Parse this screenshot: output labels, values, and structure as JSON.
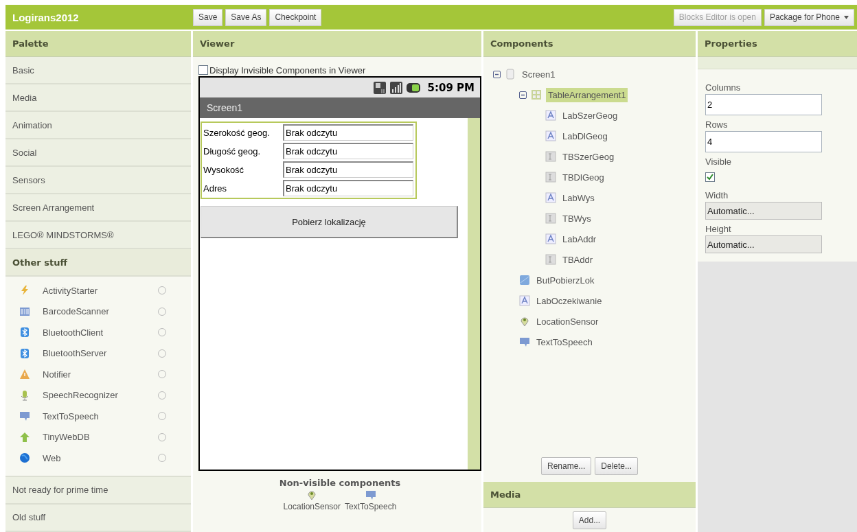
{
  "app_title": "Logirans2012",
  "toolbar": {
    "left": [
      {
        "label": "Save",
        "disabled": false,
        "menu": false
      },
      {
        "label": "Save As",
        "disabled": false,
        "menu": false
      },
      {
        "label": "Checkpoint",
        "disabled": false,
        "menu": false
      }
    ],
    "right": [
      {
        "label": "Blocks Editor is open",
        "disabled": true,
        "menu": false
      },
      {
        "label": "Package for Phone",
        "disabled": false,
        "menu": true
      }
    ]
  },
  "palette": {
    "title": "Palette",
    "groups": [
      {
        "label": "Basic",
        "expanded": false
      },
      {
        "label": "Media",
        "expanded": false
      },
      {
        "label": "Animation",
        "expanded": false
      },
      {
        "label": "Social",
        "expanded": false
      },
      {
        "label": "Sensors",
        "expanded": false
      },
      {
        "label": "Screen Arrangement",
        "expanded": false
      },
      {
        "label": "LEGO® MINDSTORMS®",
        "expanded": false
      },
      {
        "label": "Other stuff",
        "expanded": true,
        "items": [
          {
            "label": "ActivityStarter",
            "kind": "bolt"
          },
          {
            "label": "BarcodeScanner",
            "kind": "barcode"
          },
          {
            "label": "BluetoothClient",
            "kind": "bluetooth"
          },
          {
            "label": "BluetoothServer",
            "kind": "bluetooth"
          },
          {
            "label": "Notifier",
            "kind": "warning"
          },
          {
            "label": "SpeechRecognizer",
            "kind": "microphone"
          },
          {
            "label": "TextToSpeech",
            "kind": "speech"
          },
          {
            "label": "TinyWebDB",
            "kind": "arrow"
          },
          {
            "label": "Web",
            "kind": "globe"
          }
        ]
      },
      {
        "label": "Not ready for prime time",
        "expanded": false
      },
      {
        "label": "Old stuff",
        "expanded": false
      }
    ]
  },
  "viewer": {
    "title": "Viewer",
    "invisible_toggle": {
      "label": "Display Invisible Components in Viewer",
      "checked": false
    },
    "phone": {
      "time": "5:09 PM",
      "screen_title": "Screen1",
      "rows": [
        {
          "label": "Szerokość geog.",
          "value": "Brak odczytu"
        },
        {
          "label": "Długość geog.",
          "value": "Brak odczytu"
        },
        {
          "label": "Wysokość",
          "value": "Brak odczytu"
        },
        {
          "label": "Adres",
          "value": "Brak odczytu"
        }
      ],
      "button": "Pobierz lokalizację"
    },
    "non_visible": {
      "title": "Non-visible components",
      "items": [
        {
          "label": "LocationSensor",
          "kind": "pin"
        },
        {
          "label": "TextToSpeech",
          "kind": "speech"
        }
      ]
    }
  },
  "components": {
    "title": "Components",
    "tree": [
      {
        "label": "Screen1",
        "kind": "screen",
        "selected": false,
        "expanded": true,
        "children": [
          {
            "label": "TableArrangement1",
            "kind": "table",
            "selected": true,
            "expanded": true,
            "children": [
              {
                "label": "LabSzerGeog",
                "kind": "label",
                "selected": false
              },
              {
                "label": "LabDlGeog",
                "kind": "label",
                "selected": false
              },
              {
                "label": "TBSzerGeog",
                "kind": "textbox",
                "selected": false
              },
              {
                "label": "TBDlGeog",
                "kind": "textbox",
                "selected": false
              },
              {
                "label": "LabWys",
                "kind": "label",
                "selected": false
              },
              {
                "label": "TBWys",
                "kind": "textbox",
                "selected": false
              },
              {
                "label": "LabAddr",
                "kind": "label",
                "selected": false
              },
              {
                "label": "TBAddr",
                "kind": "textbox",
                "selected": false
              }
            ]
          },
          {
            "label": "ButPobierzLok",
            "kind": "button",
            "selected": false
          },
          {
            "label": "LabOczekiwanie",
            "kind": "label",
            "selected": false
          },
          {
            "label": "LocationSensor",
            "kind": "pin",
            "selected": false
          },
          {
            "label": "TextToSpeech",
            "kind": "speech",
            "selected": false
          }
        ]
      }
    ],
    "buttons": [
      "Rename...",
      "Delete..."
    ]
  },
  "media": {
    "title": "Media",
    "button": "Add..."
  },
  "properties": {
    "title": "Properties",
    "fields": [
      {
        "label": "Columns",
        "kind": "text",
        "value": "2"
      },
      {
        "label": "Rows",
        "kind": "text",
        "value": "4"
      },
      {
        "label": "Visible",
        "kind": "checkbox",
        "checked": true
      },
      {
        "label": "Width",
        "kind": "choice",
        "value": "Automatic..."
      },
      {
        "label": "Height",
        "kind": "choice",
        "value": "Automatic..."
      }
    ]
  }
}
